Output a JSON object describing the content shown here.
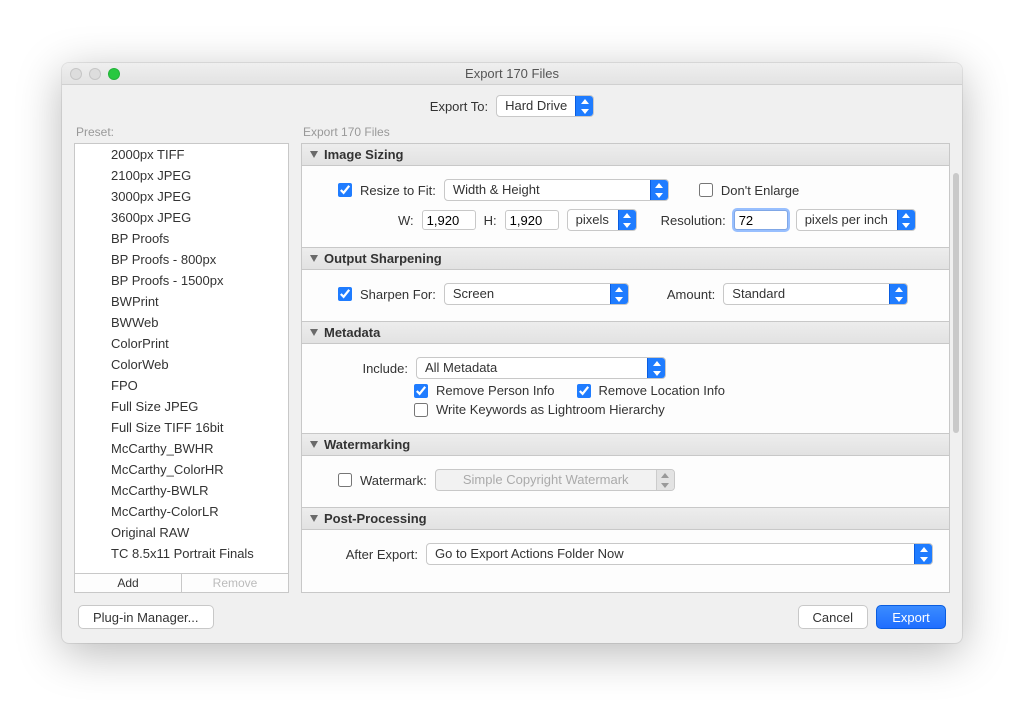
{
  "window": {
    "title": "Export 170 Files"
  },
  "header": {
    "export_to_label": "Export To:",
    "export_to_value": "Hard Drive"
  },
  "preset": {
    "label": "Preset:",
    "items": [
      "2000px TIFF",
      "2100px JPEG",
      "3000px JPEG",
      "3600px JPEG",
      "BP Proofs",
      "BP Proofs - 800px",
      "BP Proofs - 1500px",
      "BWPrint",
      "BWWeb",
      "ColorPrint",
      "ColorWeb",
      "FPO",
      "Full Size JPEG",
      "Full Size TIFF 16bit",
      "McCarthy_BWHR",
      "McCarthy_ColorHR",
      "McCarthy-BWLR",
      "McCarthy-ColorLR",
      "Original RAW",
      "TC 8.5x11 Portrait Finals"
    ],
    "add_label": "Add",
    "remove_label": "Remove"
  },
  "main_sublabel": "Export 170 Files",
  "sections": {
    "sizing": {
      "title": "Image Sizing",
      "resize_label": "Resize to Fit:",
      "resize_checked": true,
      "mode": "Width & Height",
      "dont_enlarge_label": "Don't Enlarge",
      "dont_enlarge_checked": false,
      "w_label": "W:",
      "w_val": "1,920",
      "h_label": "H:",
      "h_val": "1,920",
      "unit": "pixels",
      "res_label": "Resolution:",
      "res_val": "72",
      "res_unit": "pixels per inch"
    },
    "sharpen": {
      "title": "Output Sharpening",
      "label": "Sharpen For:",
      "checked": true,
      "target": "Screen",
      "amount_label": "Amount:",
      "amount": "Standard"
    },
    "metadata": {
      "title": "Metadata",
      "include_label": "Include:",
      "include_val": "All Metadata",
      "remove_person_label": "Remove Person Info",
      "remove_person_checked": true,
      "remove_location_label": "Remove Location Info",
      "remove_location_checked": true,
      "write_keywords_label": "Write Keywords as Lightroom Hierarchy",
      "write_keywords_checked": false
    },
    "watermark": {
      "title": "Watermarking",
      "label": "Watermark:",
      "checked": false,
      "value": "Simple Copyright Watermark"
    },
    "post": {
      "title": "Post-Processing",
      "label": "After Export:",
      "value": "Go to Export Actions Folder Now"
    }
  },
  "footer": {
    "plugin_manager": "Plug-in Manager...",
    "cancel": "Cancel",
    "export": "Export"
  }
}
